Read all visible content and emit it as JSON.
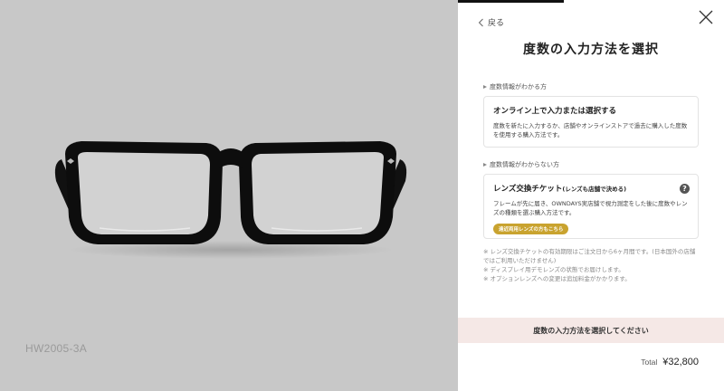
{
  "product": {
    "code": "HW2005-3A"
  },
  "panel": {
    "back_label": "戻る",
    "title": "度数の入力方法を選択",
    "sections": [
      {
        "label": "度数情報がわかる方",
        "card": {
          "title": "オンライン上で入力または選択する",
          "description": "度数を新たに入力するか、店舗やオンラインストアで過去に購入した度数を使用する購入方法です。"
        }
      },
      {
        "label": "度数情報がわからない方",
        "card": {
          "title": "レンズ交換チケット",
          "title_suffix": "(レンズも店舗で決める)",
          "description": "フレームが先に届き、OWNDAYS実店舗で視力測定をした後に度数やレンズの種類を選ぶ購入方法です。",
          "pill": "遠近両用レンズの方もこちら",
          "help_icon": "?"
        }
      }
    ],
    "notes": [
      "※ レンズ交換チケットの有効期限はご注文日から6ヶ月間です。(日本国外の店舗ではご利用いただけません)",
      "※ ディスプレイ用デモレンズの状態でお届けします。",
      "※ オプションレンズへの変更は追加料金がかかります。"
    ],
    "cta_label": "度数の入力方法を選択してください",
    "total_label": "Total",
    "total_price": "¥32,800"
  },
  "colors": {
    "left_background": "#c8c8c8",
    "cta_background": "#f5e8e6",
    "pill": "#c9a32f"
  }
}
